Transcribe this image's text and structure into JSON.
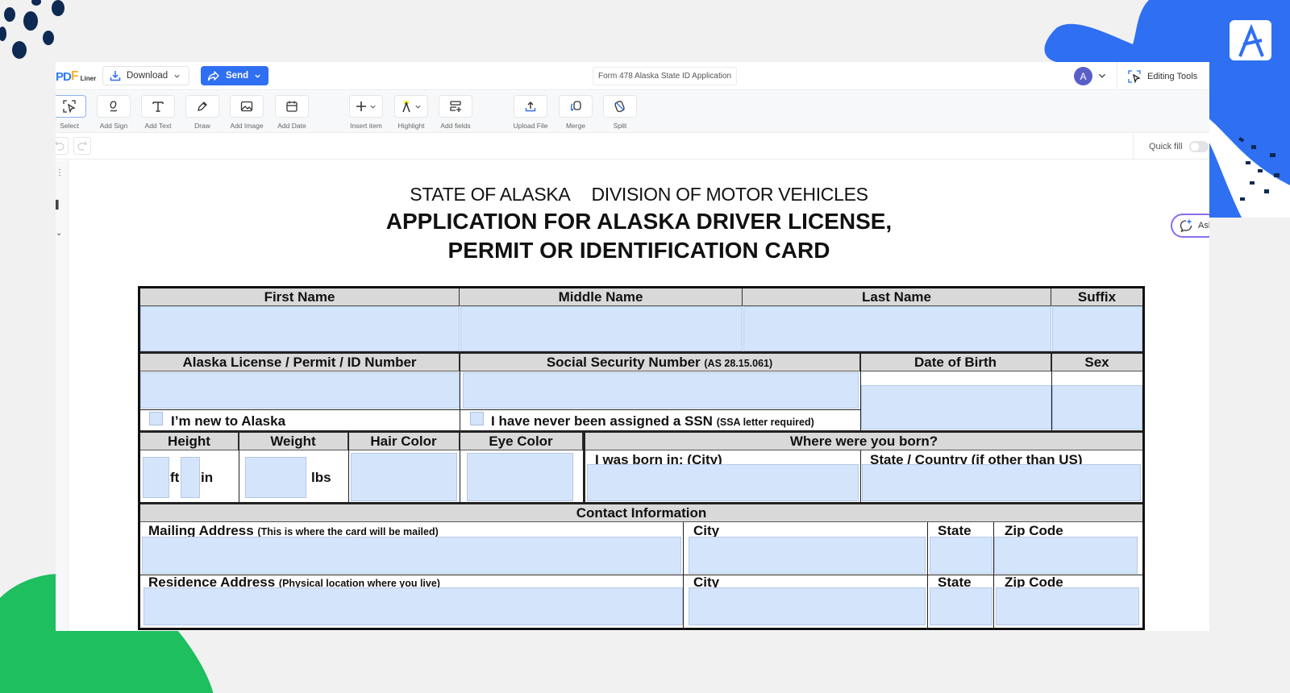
{
  "app": {
    "logo": {
      "part1": "PD",
      "part2": "F",
      "part3": "Liner"
    },
    "download_label": "Download",
    "send_label": "Send",
    "document_name": "Form 478 Alaska State ID Application",
    "avatar_initial": "A",
    "editing_tools_label": "Editing Tools",
    "quick_fill_label": "Quick fill",
    "quick_fill_enabled": false,
    "ask_label": "Ask",
    "brand_color": "#2f6ff2",
    "avatar_color": "#5a5fc8"
  },
  "toolbar": {
    "tools": [
      {
        "id": "select",
        "label": "Select",
        "icon": "select-cursor-icon",
        "active": true
      },
      {
        "id": "add-sign",
        "label": "Add Sign",
        "icon": "signature-icon"
      },
      {
        "id": "add-text",
        "label": "Add Text",
        "icon": "text-icon"
      },
      {
        "id": "draw",
        "label": "Draw",
        "icon": "pen-icon"
      },
      {
        "id": "add-image",
        "label": "Add Image",
        "icon": "image-icon"
      },
      {
        "id": "add-date",
        "label": "Add Date",
        "icon": "calendar-icon"
      },
      {
        "id": "insert-item",
        "label": "Insert item",
        "icon": "plus-icon"
      },
      {
        "id": "highlight",
        "label": "Highlight",
        "icon": "highlighter-icon"
      },
      {
        "id": "add-fields",
        "label": "Add fields",
        "icon": "add-fields-icon"
      },
      {
        "id": "upload-file",
        "label": "Upload File",
        "icon": "upload-icon"
      },
      {
        "id": "merge",
        "label": "Merge",
        "icon": "merge-icon"
      },
      {
        "id": "split",
        "label": "Split",
        "icon": "split-icon"
      }
    ]
  },
  "document": {
    "agency_left": "STATE OF ALASKA",
    "agency_right": "DIVISION OF MOTOR VEHICLES",
    "title_line1": "APPLICATION FOR ALASKA DRIVER LICENSE,",
    "title_line2": "PERMIT OR IDENTIFICATION CARD",
    "form": {
      "first_name": "First Name",
      "middle_name": "Middle Name",
      "last_name": "Last Name",
      "suffix": "Suffix",
      "license_number": "Alaska License / Permit / ID Number",
      "ssn": "Social Security Number",
      "ssn_note": "(AS 28.15.061)",
      "dob": "Date of Birth",
      "sex": "Sex",
      "new_to_alaska": "I’m new to Alaska",
      "no_ssn": "I have never been assigned a SSN",
      "no_ssn_note": "(SSA letter required)",
      "height": "Height",
      "weight": "Weight",
      "hair_color": "Hair Color",
      "eye_color": "Eye Color",
      "where_born": "Where were you born?",
      "born_city": "I was born in: (City)",
      "born_state": "State / Country (if other than US)",
      "ft_unit": "ft",
      "in_unit": "in",
      "lbs_unit": "lbs",
      "contact_info": "Contact Information",
      "mailing_address": "Mailing Address",
      "mailing_note": "(This is where the card will be mailed)",
      "residence_address": "Residence Address",
      "residence_note": "(Physical location where you live)",
      "city": "City",
      "state": "State",
      "zip": "Zip Code"
    }
  }
}
